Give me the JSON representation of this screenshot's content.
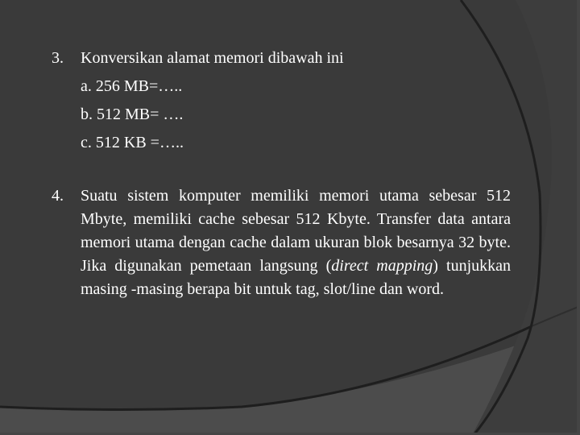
{
  "slide": {
    "colors": {
      "background": "#3a3a3a",
      "lower_band": "#4c4c4c",
      "arc_stroke": "#1e1e1e",
      "text": "#ffffff"
    },
    "question3": {
      "number": "3.",
      "text": "Konversikan alamat memori dibawah ini",
      "items": [
        "a. 256 MB=…..",
        "b. 512 MB= ….",
        "c. 512 KB =….."
      ]
    },
    "question4": {
      "number": "4.",
      "text_before_italic": "Suatu sistem komputer memiliki memori utama sebesar 512 Mbyte, memiliki cache sebesar 512 Kbyte. Transfer data antara memori utama dengan cache dalam ukuran blok besarnya 32 byte. Jika digunakan pemetaan langsung (",
      "italic_text": "direct mapping",
      "text_after_italic": ") tunjukkan masing -masing berapa bit untuk tag, slot/line dan word."
    }
  }
}
